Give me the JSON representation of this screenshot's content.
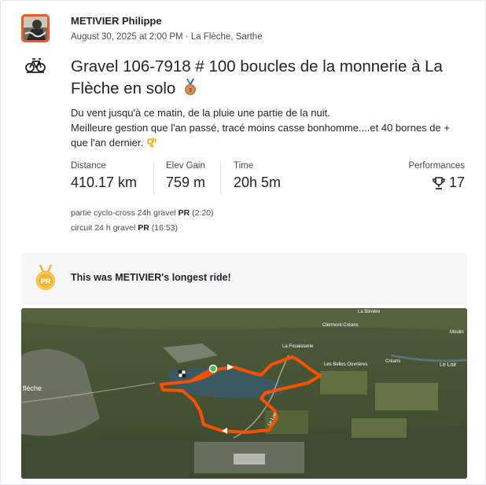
{
  "athlete": {
    "name": "METIVIER Philippe",
    "date": "August 30, 2025 at 2:00 PM",
    "location": "La Flèche, Sarthe"
  },
  "activity": {
    "sport_icon": "bike-icon",
    "title": "Gravel 106-7918 # 100 boucles de la monnerie à La Flèche en solo",
    "title_emoji": "bronze-medal-icon",
    "description_line1": "Du vent jusqu'à ce matin, de la pluie une partie de la nuit.",
    "description_line2": "Meilleure gestion que l'an passé, tracé moins casse bonhomme....et 40 bornes de +",
    "description_line3": "que l'an dernier.",
    "description_emoji": "ok-hand-icon"
  },
  "stats": {
    "distance_label": "Distance",
    "distance_value": "410.17 km",
    "elev_label": "Elev Gain",
    "elev_value": "759 m",
    "time_label": "Time",
    "time_value": "20h 5m",
    "performances_label": "Performances",
    "performances_value": "17"
  },
  "segments": [
    {
      "name": "partie cyclo-cross 24h gravel",
      "badge": "PR",
      "time": "(2:20)"
    },
    {
      "name": "circuit 24 h gravel",
      "badge": "PR",
      "time": "(16:53)"
    }
  ],
  "achievement": {
    "badge": "PR",
    "text": "This was METIVIER's longest ride!"
  },
  "map": {
    "labels": [
      "La Blinière",
      "Clermont-Créans",
      "La Fouaisserie",
      "Les Belles Ouvrières",
      "Créans",
      "Le Loir",
      "flèche",
      "Le Loir",
      "Moulin"
    ],
    "route_color": "#fc5200",
    "start_color": "#3ac45d"
  }
}
